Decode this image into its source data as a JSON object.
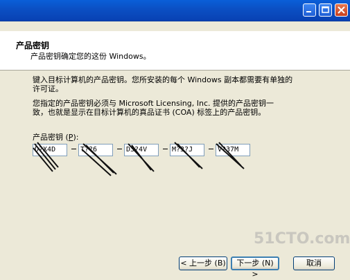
{
  "titlebar": {
    "buttons": [
      {
        "name": "minimize-button",
        "icon": "minimize-icon"
      },
      {
        "name": "maximize-button",
        "icon": "maximize-icon"
      },
      {
        "name": "close-button",
        "icon": "close-icon"
      }
    ]
  },
  "header": {
    "title": "产品密钥",
    "subtitle": "产品密钥确定您的这份 Windows。"
  },
  "body": {
    "para1_line1": "键入目标计算机的产品密钥。您所安装的每个 Windows 副本都需要有单独的",
    "para1_line2": "许可证。",
    "para2_line1": "您指定的产品密钥必须与 Microsoft Licensing, Inc. 提供的产品密钥一",
    "para2_line2": "致，也就是显示在目标计算机的真品证书 (COA) 标签上的产品密钥。"
  },
  "product_key": {
    "label_prefix": "产品密钥 (",
    "label_hotkey": "P",
    "label_suffix": "):",
    "fields": [
      "D?X4D",
      "T??6",
      "D3?4V",
      "M?3?J",
      "V?37M"
    ]
  },
  "watermark": "51CTO.com",
  "footer": {
    "back_label": "< 上一步 (B)",
    "next_label": "下一步 (N) >",
    "cancel_label": "取消"
  }
}
